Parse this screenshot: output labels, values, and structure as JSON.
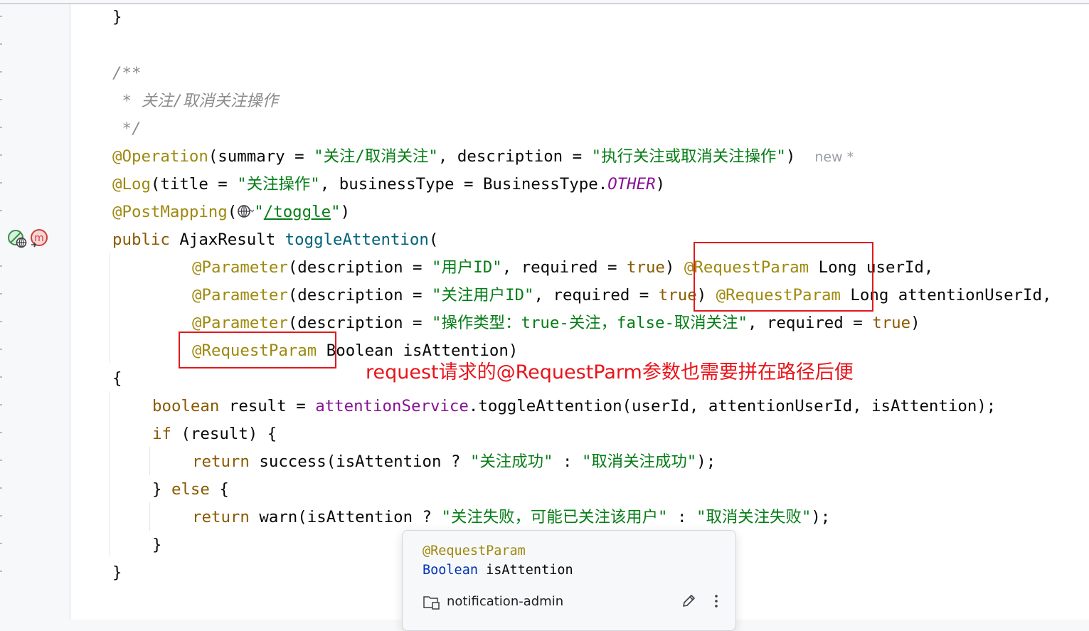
{
  "code": {
    "l1": "}",
    "doc_open": "/**",
    "doc_body": " * 关注/取消关注操作",
    "doc_close": " */",
    "op_ann": "@Operation",
    "op_p1": "(summary = ",
    "op_s1": "\"关注/取消关注\"",
    "op_p2": ", description = ",
    "op_s2": "\"执行关注或取消关注操作\"",
    "op_p3": ")",
    "op_hint": "new *",
    "log_ann": "@Log",
    "log_p1": "(title = ",
    "log_s1": "\"关注操作\"",
    "log_p2": ", businessType = BusinessType.",
    "log_const": "OTHER",
    "log_p3": ")",
    "pm_ann": "@PostMapping",
    "pm_p1": "(",
    "pm_q1": "\"",
    "pm_url": "/toggle",
    "pm_q2": "\"",
    "pm_p2": ")",
    "sig_kw": "public",
    "sig_type": " AjaxResult ",
    "sig_fn": "toggleAttention",
    "sig_p": "(",
    "p1_ann": "@Parameter",
    "p1_a": "(description = ",
    "p1_s": "\"用户ID\"",
    "p1_b": ", required = ",
    "p1_kw": "true",
    "p1_c": ") ",
    "p1_rp": "@RequestParam",
    "p1_d": " Long userId,",
    "p2_ann": "@Parameter",
    "p2_a": "(description = ",
    "p2_s": "\"关注用户ID\"",
    "p2_b": ", required = ",
    "p2_kw": "true",
    "p2_c": ") ",
    "p2_rp": "@RequestParam",
    "p2_d": " Long attentionUserId,",
    "p3_ann": "@Parameter",
    "p3_a": "(description = ",
    "p3_s": "\"操作类型：true-关注，false-取消关注\"",
    "p3_b": ", required = ",
    "p3_kw": "true",
    "p3_c": ")",
    "p4_rp": "@RequestParam",
    "p4_d": " Boolean isAttention)",
    "brace_open": "{",
    "b1_kw": "boolean",
    "b1_a": " result = ",
    "b1_fld": "attentionService",
    "b1_b": ".toggleAttention(userId, attentionUserId, isAttention);",
    "if_kw": "if",
    "if_a": " (result) {",
    "r1_kw": "return",
    "r1_a": " success(isAttention ? ",
    "r1_s1": "\"关注成功\"",
    "r1_b": " : ",
    "r1_s2": "\"取消关注成功\"",
    "r1_c": ");",
    "else_a": "} ",
    "else_kw": "else",
    "else_b": " {",
    "r2_kw": "return",
    "r2_a": " warn(isAttention ? ",
    "r2_s1": "\"关注失败，可能已关注该用户\"",
    "r2_b": " : ",
    "r2_s2": "\"取消关注失败\"",
    "r2_c": ");",
    "inner_close": "}",
    "outer_close": "}"
  },
  "annotation_note": "request请求的@RequestParm参数也需要拼在路径后便",
  "popup": {
    "line1": "@RequestParam",
    "line2_type": "Boolean",
    "line2_name": " isAttention",
    "project": "notification-admin"
  },
  "gutter_icons": [
    "web-endpoint-icon",
    "method-marker-icon"
  ],
  "colors": {
    "keyword": "#0033b3",
    "annotation": "#9e880d",
    "string": "#067d17",
    "comment": "#8c8c8c",
    "method": "#00627a",
    "field": "#871094",
    "highlight_box": "#e0191b",
    "note_text": "#e8141a"
  }
}
